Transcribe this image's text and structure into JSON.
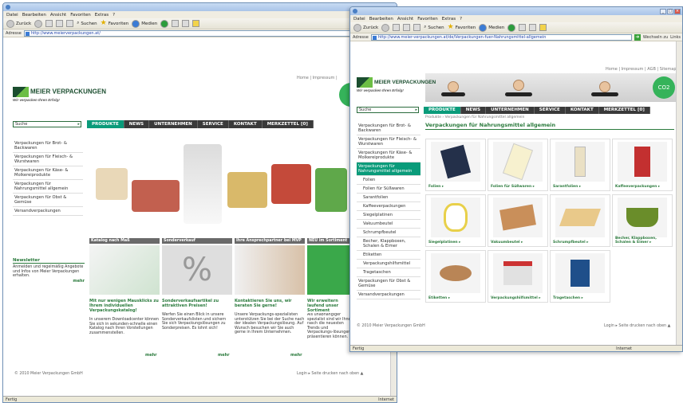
{
  "browser": {
    "menu": [
      "Datei",
      "Bearbeiten",
      "Ansicht",
      "Favoriten",
      "Extras",
      "?"
    ],
    "back": "Zurück",
    "search": "Suchen",
    "favorites": "Favoriten",
    "media": "Medien",
    "address_label": "Adresse",
    "status_left": "Fertig",
    "status_right": "Internet",
    "wechseln": "Wechseln zu",
    "links": "Links"
  },
  "win1": {
    "url": "http://www.meierverpackungen.at/",
    "logo": "MEIER VERPACKUNGEN",
    "slogan": "Wir verpacken Ihren Erfolg!",
    "toplinks": "Home | Impressum |",
    "search_placeholder": "Suche",
    "nav": [
      "PRODUKTE",
      "NEWS",
      "UNTERNEHMEN",
      "SERVICE",
      "KONTAKT",
      "MERKZETTEL [0]"
    ],
    "side": [
      "Verpackungen für Brot- & Backwaren",
      "Verpackungen für Fleisch- & Wurstwaren",
      "Verpackungen für Käse- & Molkereiprodukte",
      "Verpackungen für Nahrungsmittel allgemein",
      "Verpackungen für Obst & Gemüse",
      "Versandverpackungen"
    ],
    "newsletter": {
      "title": "Newsletter",
      "text": "Anmelden und regelmäßig Angebote und Infos von Meier Verpackungen erhalten.",
      "more": "mehr"
    },
    "cols": [
      {
        "head": "Katalog nach Maß",
        "title": "Mit nur wenigen Mausklicks zu Ihrem individuellen Verpackungskatalog!",
        "text": "In unserem Downloadcenter können Sie sich in sekunden-schnelle einen Katalog nach Ihren Vorstellungen zusammenstellen.",
        "more": "mehr"
      },
      {
        "head": "Sonderverkauf",
        "title": "Sonderverkaufsartikel zu attraktiven Preisen!",
        "text": "Werfen Sie einen Blick in unsere Sonderverkaufslisten und sichern Sie sich Verpackungslösungen zu Sonderpreisen. Es lohnt sich!",
        "more": "mehr"
      },
      {
        "head": "Ihre Ansprechpartner bei MVP",
        "title": "Kontaktieren Sie uns, wir beraten Sie gerne!",
        "text": "Unsere Verpackungs-spezialisten unterstützen Sie bei der Suche nach der idealen Verpackungslösung. Auf Wunsch besuchen wir Sie auch gerne in Ihrem Unternehmen.",
        "more": "mehr"
      },
      {
        "head": "NEU im Sortiment",
        "title": "Wir erweitern laufend unser Sortiment",
        "text": "Als unabhängiger spezialist sind wir Ihnen rasch die neuesten Trends und Verpackungs-lösungen präsentieren können.",
        "more": ""
      }
    ],
    "footer": "© 2010 Meier Verpackungen GmbH",
    "footer_right": "Login ▸  Seite drucken  nach oben ▲"
  },
  "win2": {
    "url": "http://www.meier-verpackungen.at/de/Verpackungen-fuer-Nahrungsmittel-allgemein",
    "toplinks": "Home | Impressum | AGB | Sitemap",
    "co2": "CO2",
    "nav": [
      "PRODUKTE",
      "NEWS",
      "UNTERNEHMEN",
      "SERVICE",
      "KONTAKT",
      "MERKZETTEL [0]"
    ],
    "side": [
      "Verpackungen für Brot- & Backwaren",
      "Verpackungen für Fleisch- & Wurstwaren",
      "Verpackungen für Käse- & Molkereiprodukte",
      "Verpackungen für Nahrungsmittel allgemein",
      "Folien",
      "Folien für Süßwaren",
      "Sarantfolien",
      "Kaffeeverpackungen",
      "Siegelplatinen",
      "Vakuumbeutel",
      "Schrumpfbeutel",
      "Becher, Klappboxen, Schalen & Eimer",
      "Etiketten",
      "Verpackungshilfsmittel",
      "Tragetaschen",
      "Verpackungen für Obst & Gemüse",
      "Versandverpackungen"
    ],
    "breadcrumb": "Produkte › Verpackungen für Nahrungsmittel allgemein",
    "heading": "Verpackungen für Nahrungsmittel allgemein",
    "tiles": [
      "Folien ▸",
      "Folien für Süßwaren ▸",
      "Sarantfolien ▸",
      "Kaffeeverpackungen ▸",
      "Siegelplatinen ▸",
      "Vakuumbeutel ▸",
      "Schrumpfbeutel ▸",
      "Becher, Klappboxen, Schalen & Eimer ▸",
      "Etiketten ▸",
      "Verpackungshilfsmittel ▸",
      "Tragetaschen ▸"
    ],
    "footer": "© 2010 Meier Verpackungen GmbH",
    "footer_right": "Login ▸  Seite drucken  nach oben ▲"
  },
  "colors": {
    "accent": "#0a9b7a",
    "nav": "#3a3a3a",
    "brand": "#1b4e2f"
  }
}
